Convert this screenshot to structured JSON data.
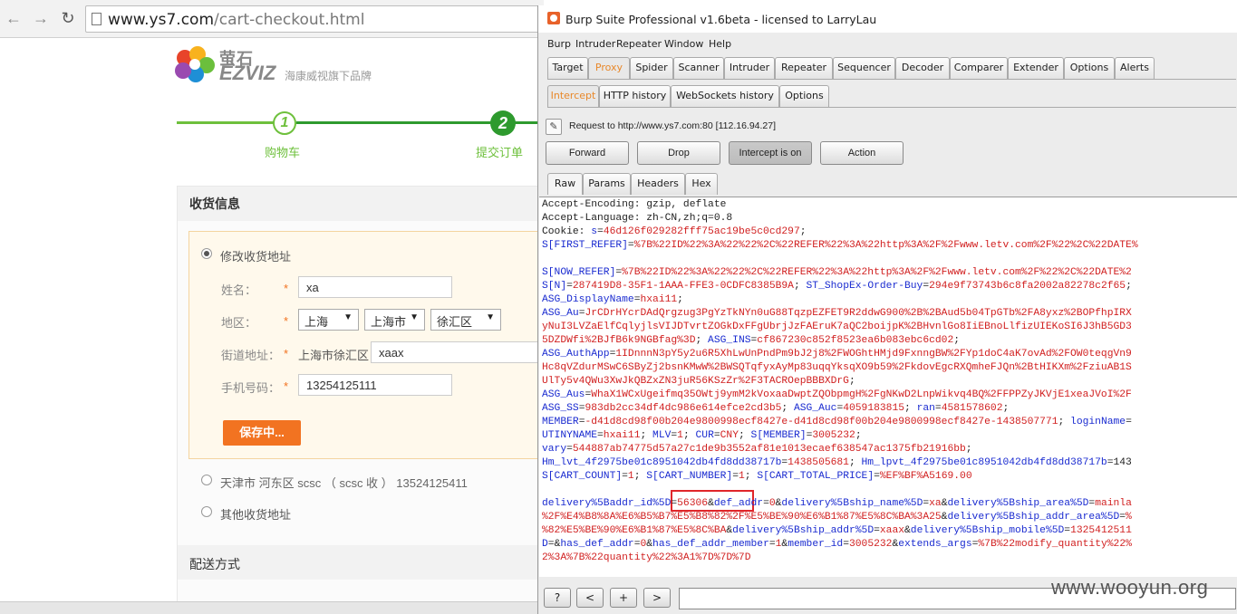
{
  "browser": {
    "url_domain": "www.ys7.com",
    "url_path": "/cart-checkout.html",
    "logo_cn": "萤石",
    "logo_en": "EZVIZ",
    "logo_sub": "海康威视旗下品牌",
    "steps": [
      {
        "num": "1",
        "label": "购物车"
      },
      {
        "num": "2",
        "label": "提交订单"
      }
    ],
    "section_shipping": "收货信息",
    "address_edit_label": "修改收货地址",
    "form": {
      "name_label": "姓名：",
      "name_value": "xa",
      "region_label": "地区：",
      "province": "上海",
      "city": "上海市",
      "district": "徐汇区",
      "street_label": "街道地址：",
      "street_prefix": "上海市徐汇区",
      "street_value": "xaax",
      "phone_label": "手机号码：",
      "phone_value": "13254125111",
      "required_mark": "*"
    },
    "save_button": "保存中...",
    "other_address_1": "天津市 河东区 scsc （ scsc 收 ） 13524125411",
    "other_address_2": "其他收货地址",
    "section_delivery": "配送方式"
  },
  "burp": {
    "title": "Burp Suite Professional v1.6beta - licensed to LarryLau",
    "menu": [
      "Burp",
      "Intruder",
      "Repeater",
      "Window",
      "Help"
    ],
    "main_tabs": [
      "Target",
      "Proxy",
      "Spider",
      "Scanner",
      "Intruder",
      "Repeater",
      "Sequencer",
      "Decoder",
      "Comparer",
      "Extender",
      "Options",
      "Alerts"
    ],
    "active_main_tab": "Proxy",
    "sub_tabs": [
      "Intercept",
      "HTTP history",
      "WebSockets history",
      "Options"
    ],
    "request_line": "Request to http://www.ys7.com:80  [112.16.94.27]",
    "buttons": {
      "forward": "Forward",
      "drop": "Drop",
      "intercept": "Intercept is on",
      "action": "Action"
    },
    "view_tabs": [
      "Raw",
      "Params",
      "Headers",
      "Hex"
    ],
    "footer_buttons": [
      "?",
      "<",
      "+",
      ">"
    ]
  },
  "request_lines": [
    [
      {
        "t": "Accept-Encoding: gzip, deflate",
        "c": ""
      }
    ],
    [
      {
        "t": "Accept-Language: zh-CN,zh;q=0.8",
        "c": ""
      }
    ],
    [
      {
        "t": "Cookie: ",
        "c": ""
      },
      {
        "t": "s",
        "c": "blue"
      },
      {
        "t": "=",
        "c": ""
      },
      {
        "t": "46d126f029282fff75ac19be5c0cd297",
        "c": "red"
      },
      {
        "t": ";",
        "c": ""
      }
    ],
    [
      {
        "t": "S[FIRST_REFER]",
        "c": "blue"
      },
      {
        "t": "=",
        "c": ""
      },
      {
        "t": "%7B%22ID%22%3A%22%22%2C%22REFER%22%3A%22http%3A%2F%2Fwww.letv.com%2F%22%2C%22DATE%",
        "c": "red"
      }
    ],
    [
      {
        "t": "",
        "c": ""
      }
    ],
    [
      {
        "t": "S[NOW_REFER]",
        "c": "blue"
      },
      {
        "t": "=",
        "c": ""
      },
      {
        "t": "%7B%22ID%22%3A%22%22%2C%22REFER%22%3A%22http%3A%2F%2Fwww.letv.com%2F%22%2C%22DATE%2",
        "c": "red"
      }
    ],
    [
      {
        "t": "S[N]",
        "c": "blue"
      },
      {
        "t": "=",
        "c": ""
      },
      {
        "t": "287419D8-35F1-1AAA-FFE3-0CDFC8385B9A",
        "c": "red"
      },
      {
        "t": "; ",
        "c": ""
      },
      {
        "t": "ST_ShopEx-Order-Buy",
        "c": "blue"
      },
      {
        "t": "=",
        "c": ""
      },
      {
        "t": "294e9f73743b6c8fa2002a82278c2f65",
        "c": "red"
      },
      {
        "t": ";",
        "c": ""
      }
    ],
    [
      {
        "t": "ASG_DisplayName",
        "c": "blue"
      },
      {
        "t": "=",
        "c": ""
      },
      {
        "t": "hxai11",
        "c": "red"
      },
      {
        "t": ";",
        "c": ""
      }
    ],
    [
      {
        "t": "ASG_Au",
        "c": "blue"
      },
      {
        "t": "=",
        "c": ""
      },
      {
        "t": "JrCDrHYcrDAdQrgzug3PgYzTkNYn0uG88TqzpEZFET9R2ddwG900%2B%2BAud5b04TpGTb%2FA8yxz%2BOPfhpIRX",
        "c": "red"
      }
    ],
    [
      {
        "t": "yNuI3LVZaElfCqlyjlsVIJDTvrtZOGkDxFFgUbrjJzFAEruK7aQC2boijpK%2BHvnlGo8IiEBnoLlfizUIEKoSI6J3hB5GD3",
        "c": "red"
      }
    ],
    [
      {
        "t": "5DZDWfi%2BJfB6k9NGBfag%3D",
        "c": "red"
      },
      {
        "t": "; ",
        "c": ""
      },
      {
        "t": "ASG_INS",
        "c": "blue"
      },
      {
        "t": "=",
        "c": ""
      },
      {
        "t": "cf867230c852f8523ea6b083ebc6cd02",
        "c": "red"
      },
      {
        "t": ";",
        "c": ""
      }
    ],
    [
      {
        "t": "ASG_AuthApp",
        "c": "blue"
      },
      {
        "t": "=",
        "c": ""
      },
      {
        "t": "1IDnnnN3pY5y2u6R5XhLwUnPndPm9bJ2j8%2FWOGhtHMjd9FxnngBW%2FYp1doC4aK7ovAd%2FOW0teqgVn9",
        "c": "red"
      }
    ],
    [
      {
        "t": "Hc8qVZdurMSwC6SByZj2bsnKMwW%2BWSQTqfyxAyMp83uqqYksqXO9b59%2FkdovEgcRXQmheFJQn%2BtHIKXm%2FziuAB1S",
        "c": "red"
      }
    ],
    [
      {
        "t": "UlTy5v4QWu3XwJkQBZxZN3juR56KSzZr%2F3TACROepBBBXDrG",
        "c": "red"
      },
      {
        "t": ";",
        "c": ""
      }
    ],
    [
      {
        "t": "ASG_Aus",
        "c": "blue"
      },
      {
        "t": "=",
        "c": ""
      },
      {
        "t": "WhaX1WCxUgeifmq35OWtj9ymM2kVoxaaDwptZQObpmgH%2FgNKwD2LnpWikvq4BQ%2FFPPZyJKVjE1xeaJVoI%2F",
        "c": "red"
      }
    ],
    [
      {
        "t": "ASG_SS",
        "c": "blue"
      },
      {
        "t": "=",
        "c": ""
      },
      {
        "t": "983db2cc34df4dc986e614efce2cd3b5",
        "c": "red"
      },
      {
        "t": "; ",
        "c": ""
      },
      {
        "t": "ASG_Auc",
        "c": "blue"
      },
      {
        "t": "=",
        "c": ""
      },
      {
        "t": "4059183815",
        "c": "red"
      },
      {
        "t": "; ",
        "c": ""
      },
      {
        "t": "ran",
        "c": "blue"
      },
      {
        "t": "=",
        "c": ""
      },
      {
        "t": "4581578602",
        "c": "red"
      },
      {
        "t": ";",
        "c": ""
      }
    ],
    [
      {
        "t": "MEMBER",
        "c": "blue"
      },
      {
        "t": "=",
        "c": ""
      },
      {
        "t": "-d41d8cd98f00b204e9800998ecf8427e-d41d8cd98f00b204e9800998ecf8427e-1438507771",
        "c": "red"
      },
      {
        "t": "; ",
        "c": ""
      },
      {
        "t": "loginName",
        "c": "blue"
      },
      {
        "t": "=",
        "c": ""
      }
    ],
    [
      {
        "t": "UTINYNAME",
        "c": "blue"
      },
      {
        "t": "=",
        "c": ""
      },
      {
        "t": "hxai11",
        "c": "red"
      },
      {
        "t": "; ",
        "c": ""
      },
      {
        "t": "MLV",
        "c": "blue"
      },
      {
        "t": "=",
        "c": ""
      },
      {
        "t": "1",
        "c": "red"
      },
      {
        "t": "; ",
        "c": ""
      },
      {
        "t": "CUR",
        "c": "blue"
      },
      {
        "t": "=",
        "c": ""
      },
      {
        "t": "CNY",
        "c": "red"
      },
      {
        "t": "; ",
        "c": ""
      },
      {
        "t": "S[MEMBER]",
        "c": "blue"
      },
      {
        "t": "=",
        "c": ""
      },
      {
        "t": "3005232",
        "c": "red"
      },
      {
        "t": ";",
        "c": ""
      }
    ],
    [
      {
        "t": "vary",
        "c": "blue"
      },
      {
        "t": "=",
        "c": ""
      },
      {
        "t": "544887ab74775d57a27c1de9b3552af81e1013ecaef638547ac1375fb21916bb",
        "c": "red"
      },
      {
        "t": ";",
        "c": ""
      }
    ],
    [
      {
        "t": "Hm_lvt_4f2975be01c8951042db4fd8dd38717b",
        "c": "blue"
      },
      {
        "t": "=",
        "c": ""
      },
      {
        "t": "1438505681",
        "c": "red"
      },
      {
        "t": "; ",
        "c": ""
      },
      {
        "t": "Hm_lpvt_4f2975be01c8951042db4fd8dd38717b",
        "c": "blue"
      },
      {
        "t": "=143",
        "c": ""
      }
    ],
    [
      {
        "t": "S[CART_COUNT]",
        "c": "blue"
      },
      {
        "t": "=",
        "c": ""
      },
      {
        "t": "1",
        "c": "red"
      },
      {
        "t": "; ",
        "c": ""
      },
      {
        "t": "S[CART_NUMBER]",
        "c": "blue"
      },
      {
        "t": "=",
        "c": ""
      },
      {
        "t": "1",
        "c": "red"
      },
      {
        "t": "; ",
        "c": ""
      },
      {
        "t": "S[CART_TOTAL_PRICE]",
        "c": "blue"
      },
      {
        "t": "=",
        "c": ""
      },
      {
        "t": "%EF%BF%A5169.00",
        "c": "red"
      }
    ],
    [
      {
        "t": "",
        "c": ""
      }
    ],
    [
      {
        "t": "delivery%5Baddr_id%5D",
        "c": "blue"
      },
      {
        "t": "=",
        "c": ""
      },
      {
        "t": "56306",
        "c": "red"
      },
      {
        "t": "&",
        "c": ""
      },
      {
        "t": "def_addr",
        "c": "blue"
      },
      {
        "t": "=",
        "c": ""
      },
      {
        "t": "0",
        "c": "red"
      },
      {
        "t": "&",
        "c": ""
      },
      {
        "t": "delivery%5Bship_name%5D",
        "c": "blue"
      },
      {
        "t": "=",
        "c": ""
      },
      {
        "t": "xa",
        "c": "red"
      },
      {
        "t": "&",
        "c": ""
      },
      {
        "t": "delivery%5Bship_area%5D",
        "c": "blue"
      },
      {
        "t": "=",
        "c": ""
      },
      {
        "t": "mainla",
        "c": "red"
      }
    ],
    [
      {
        "t": "%2F%E4%B8%8A%E6%B5%B7%E5%B8%82%2F%E5%BE%90%E6%B1%87%E5%8C%BA%3A25",
        "c": "red"
      },
      {
        "t": "&",
        "c": ""
      },
      {
        "t": "delivery%5Bship_addr_area%5D",
        "c": "blue"
      },
      {
        "t": "=",
        "c": ""
      },
      {
        "t": "%",
        "c": "red"
      }
    ],
    [
      {
        "t": "%82%E5%BE%90%E6%B1%87%E5%8C%BA",
        "c": "red"
      },
      {
        "t": "&",
        "c": ""
      },
      {
        "t": "delivery%5Bship_addr%5D",
        "c": "blue"
      },
      {
        "t": "=",
        "c": ""
      },
      {
        "t": "xaax",
        "c": "red"
      },
      {
        "t": "&",
        "c": ""
      },
      {
        "t": "delivery%5Bship_mobile%5D",
        "c": "blue"
      },
      {
        "t": "=",
        "c": ""
      },
      {
        "t": "1325412511",
        "c": "red"
      }
    ],
    [
      {
        "t": "D",
        "c": "blue"
      },
      {
        "t": "=",
        "c": ""
      },
      {
        "t": "",
        "c": "red"
      },
      {
        "t": "&",
        "c": ""
      },
      {
        "t": "has_def_addr",
        "c": "blue"
      },
      {
        "t": "=",
        "c": ""
      },
      {
        "t": "0",
        "c": "red"
      },
      {
        "t": "&",
        "c": ""
      },
      {
        "t": "has_def_addr_member",
        "c": "blue"
      },
      {
        "t": "=",
        "c": ""
      },
      {
        "t": "1",
        "c": "red"
      },
      {
        "t": "&",
        "c": ""
      },
      {
        "t": "member_id",
        "c": "blue"
      },
      {
        "t": "=",
        "c": ""
      },
      {
        "t": "3005232",
        "c": "red"
      },
      {
        "t": "&",
        "c": ""
      },
      {
        "t": "extends_args",
        "c": "blue"
      },
      {
        "t": "=",
        "c": ""
      },
      {
        "t": "%7B%22modify_quantity%22%",
        "c": "red"
      }
    ],
    [
      {
        "t": "2%3A%7B%22quantity%22%3A1%7D%7D%7D",
        "c": "red"
      }
    ]
  ],
  "watermark": "www.wooyun.org"
}
